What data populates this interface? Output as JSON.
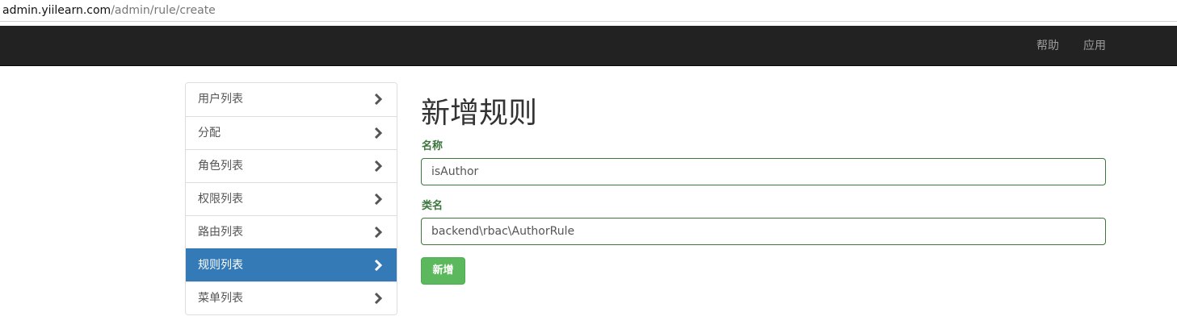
{
  "address_bar": {
    "host": "admin.yiilearn.com",
    "path": "/admin/rule/create"
  },
  "navbar": {
    "items": [
      {
        "label": "帮助"
      },
      {
        "label": "应用"
      }
    ]
  },
  "sidebar": {
    "items": [
      {
        "label": "用户列表",
        "active": false
      },
      {
        "label": "分配",
        "active": false
      },
      {
        "label": "角色列表",
        "active": false
      },
      {
        "label": "权限列表",
        "active": false
      },
      {
        "label": "路由列表",
        "active": false
      },
      {
        "label": "规则列表",
        "active": true
      },
      {
        "label": "菜单列表",
        "active": false
      }
    ],
    "chevron_icon": "chevron-right-icon"
  },
  "main": {
    "title": "新增规则",
    "fields": {
      "name": {
        "label": "名称",
        "value": "isAuthor"
      },
      "class_name": {
        "label": "类名",
        "value": "backend\\rbac\\AuthorRule"
      }
    },
    "submit_label": "新增"
  },
  "colors": {
    "navbar_bg": "#222222",
    "active_item_bg": "#337ab7",
    "success_border": "#3c763d",
    "button_bg": "#5cb85c"
  }
}
